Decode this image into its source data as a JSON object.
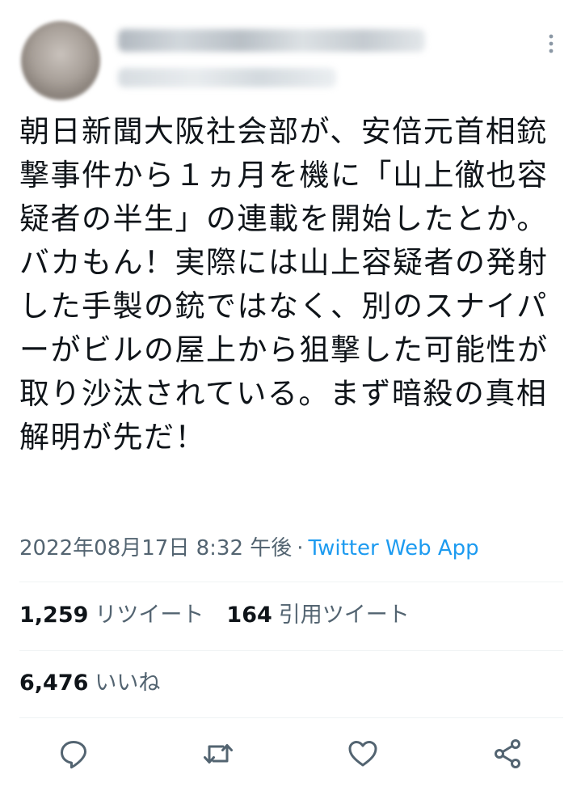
{
  "tweet": {
    "text": "朝日新聞大阪社会部が、安倍元首相銃撃事件から１ヵ月を機に「山上徹也容疑者の半生」の連載を開始したとか。バカもん！実際には山上容疑者の発射した手製の銃ではなく、別のスナイパーがビルの屋上から狙撃した可能性が取り沙汰されている。まず暗殺の真相解明が先だ！",
    "timestamp": "2022年08月17日 8:32 午後",
    "separator": "·",
    "source": "Twitter Web App"
  },
  "stats": {
    "retweets_count": "1,259",
    "retweets_label": "リツイート",
    "quotes_count": "164",
    "quotes_label": "引用ツイート",
    "likes_count": "6,476",
    "likes_label": "いいね"
  },
  "actions": {
    "reply_icon": "reply-icon",
    "retweet_icon": "retweet-icon",
    "like_icon": "heart-icon",
    "share_icon": "share-icon"
  },
  "colors": {
    "text": "#0f1419",
    "secondary": "#536471",
    "link": "#1d9bf0",
    "divider": "#eff3f4"
  }
}
